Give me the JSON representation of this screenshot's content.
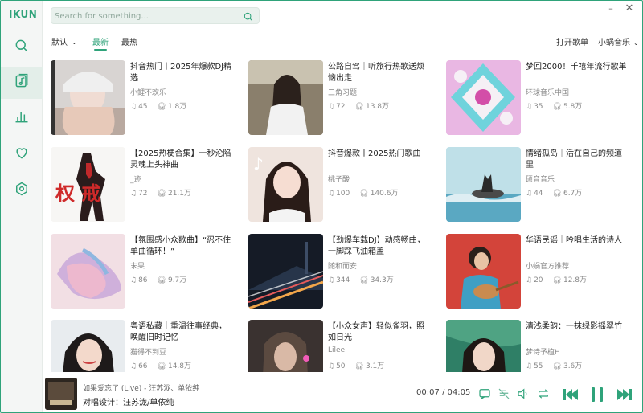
{
  "app": {
    "brand": "IKUN"
  },
  "search": {
    "placeholder": "Search for something...",
    "value": ""
  },
  "window": {
    "minimize": "–",
    "close": "✕"
  },
  "tabs": {
    "sort_label": "默认",
    "sort_chevron": "⌄",
    "items": [
      {
        "label": "最新",
        "active": true
      },
      {
        "label": "最热",
        "active": false
      }
    ]
  },
  "right_links": {
    "open_playlist": "打开歌单",
    "source": "小蜗音乐",
    "source_chevron": "⌄"
  },
  "sidebar": {
    "items": [
      {
        "icon": "search-icon"
      },
      {
        "icon": "music-library-icon",
        "active": true
      },
      {
        "icon": "chart-bars-icon"
      },
      {
        "icon": "heart-icon"
      },
      {
        "icon": "settings-hexagon-icon"
      }
    ]
  },
  "playlists": [
    {
      "title": "抖音热门丨2025年爆款DJ精选",
      "author": "小鲤不欢乐",
      "songs": "45",
      "plays": "1.8万"
    },
    {
      "title": "公路自驾｜听旅行热歌送烦恼出走",
      "author": "三角习题",
      "songs": "72",
      "plays": "13.8万"
    },
    {
      "title": "梦回2000！千禧年流行歌单",
      "author": "环球音乐中国",
      "songs": "35",
      "plays": "5.8万"
    },
    {
      "title": "【2025热梗合集】一秒沦陷灵魂上头神曲",
      "author": "_迹",
      "songs": "72",
      "plays": "21.1万"
    },
    {
      "title": "抖音爆款丨2025热门歌曲",
      "author": "桃子酸",
      "songs": "100",
      "plays": "140.6万"
    },
    {
      "title": "情绪孤岛｜活在自己的频道里",
      "author": "硕音音乐",
      "songs": "44",
      "plays": "6.7万"
    },
    {
      "title": "【氛围感小众歌曲】“忍不住单曲循环！”",
      "author": "末果",
      "songs": "86",
      "plays": "9.7万"
    },
    {
      "title": "【劲爆车载DJ】动感畅曲，一脚踩飞油箱盖",
      "author": "随和而安",
      "songs": "344",
      "plays": "34.3万"
    },
    {
      "title": "华语民谣｜吟唱生活的诗人",
      "author": "小蜗官方推荐",
      "songs": "20",
      "plays": "12.8万"
    },
    {
      "title": "粤语私藏｜重温往事经典，唤醒旧时记忆",
      "author": "猫得不到豆",
      "songs": "66",
      "plays": "14.8万"
    },
    {
      "title": "【小众女声】轻似雀羽，照如日光",
      "author": "Lilee",
      "songs": "50",
      "plays": "3.1万"
    },
    {
      "title": "清浅柔韵：一抹绿影摇翠竹",
      "author": "梦诗予植H",
      "songs": "55",
      "plays": "3.6万"
    }
  ],
  "player": {
    "title": "如果爱忘了 (Live) - 汪苏泷、单依纯",
    "lyric": "对唱设计：汪苏泷/单依纯",
    "time": "00:07 / 04:05"
  },
  "colors": {
    "accent": "#2fa37a",
    "sidebar_bg": "#f4f6f5"
  }
}
